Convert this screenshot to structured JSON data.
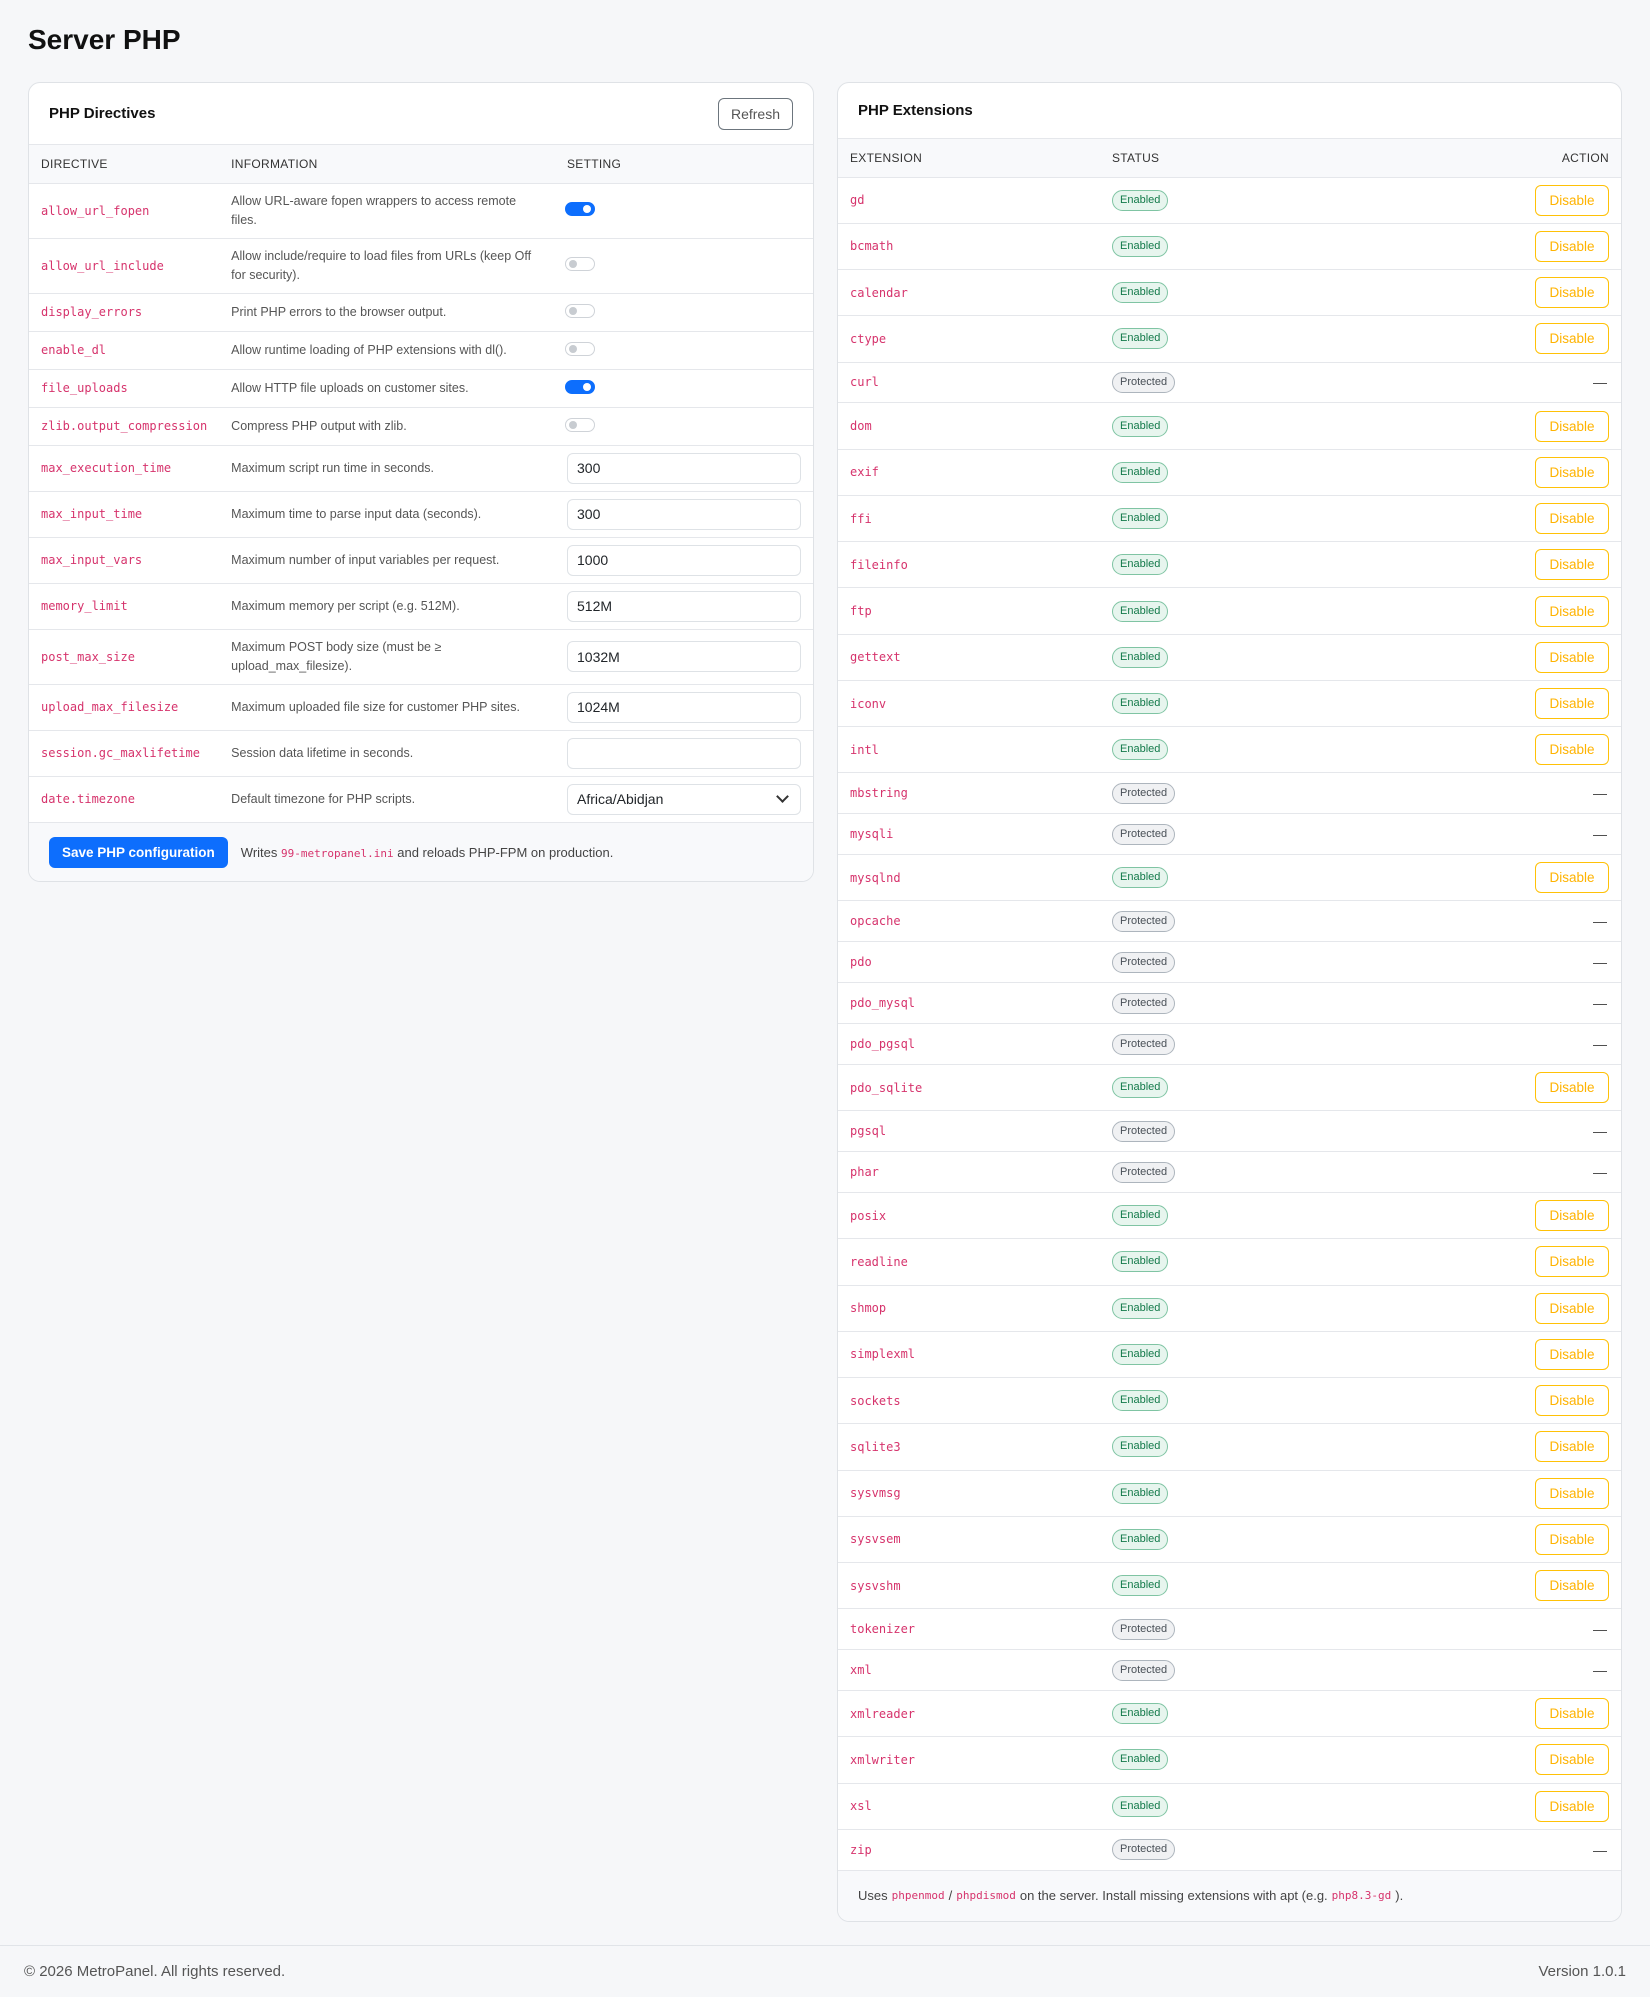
{
  "page": {
    "title": "Server PHP"
  },
  "directives_card": {
    "title": "PHP Directives",
    "refresh_label": "Refresh",
    "columns": [
      "DIRECTIVE",
      "INFORMATION",
      "SETTING"
    ],
    "rows": [
      {
        "name": "allow_url_fopen",
        "info": "Allow URL-aware fopen wrappers to access remote files.",
        "kind": "toggle",
        "on": true
      },
      {
        "name": "allow_url_include",
        "info": "Allow include/require to load files from URLs (keep Off for security).",
        "kind": "toggle",
        "on": false
      },
      {
        "name": "display_errors",
        "info": "Print PHP errors to the browser output.",
        "kind": "toggle",
        "on": false
      },
      {
        "name": "enable_dl",
        "info": "Allow runtime loading of PHP extensions with dl().",
        "kind": "toggle",
        "on": false
      },
      {
        "name": "file_uploads",
        "info": "Allow HTTP file uploads on customer sites.",
        "kind": "toggle",
        "on": true
      },
      {
        "name": "zlib.output_compression",
        "info": "Compress PHP output with zlib.",
        "kind": "toggle",
        "on": false
      },
      {
        "name": "max_execution_time",
        "info": "Maximum script run time in seconds.",
        "kind": "input",
        "value": "300"
      },
      {
        "name": "max_input_time",
        "info": "Maximum time to parse input data (seconds).",
        "kind": "input",
        "value": "300"
      },
      {
        "name": "max_input_vars",
        "info": "Maximum number of input variables per request.",
        "kind": "input",
        "value": "1000"
      },
      {
        "name": "memory_limit",
        "info": "Maximum memory per script (e.g. 512M).",
        "kind": "input",
        "value": "512M"
      },
      {
        "name": "post_max_size",
        "info": "Maximum POST body size (must be ≥ upload_max_filesize).",
        "kind": "input",
        "value": "1032M"
      },
      {
        "name": "upload_max_filesize",
        "info": "Maximum uploaded file size for customer PHP sites.",
        "kind": "input",
        "value": "1024M"
      },
      {
        "name": "session.gc_maxlifetime",
        "info": "Session data lifetime in seconds.",
        "kind": "input",
        "value": ""
      },
      {
        "name": "date.timezone",
        "info": "Default timezone for PHP scripts.",
        "kind": "select",
        "value": "Africa/Abidjan"
      }
    ],
    "save_label": "Save PHP configuration",
    "footer_prefix": "Writes",
    "footer_file": "99-metropanel.ini",
    "footer_suffix": "and reloads PHP-FPM on production."
  },
  "extensions_card": {
    "title": "PHP Extensions",
    "columns": [
      "EXTENSION",
      "STATUS",
      "ACTION"
    ],
    "enabled_label": "Enabled",
    "protected_label": "Protected",
    "disable_label": "Disable",
    "dash": "—",
    "rows": [
      {
        "name": "gd",
        "status": "Enabled"
      },
      {
        "name": "bcmath",
        "status": "Enabled"
      },
      {
        "name": "calendar",
        "status": "Enabled"
      },
      {
        "name": "ctype",
        "status": "Enabled"
      },
      {
        "name": "curl",
        "status": "Protected"
      },
      {
        "name": "dom",
        "status": "Enabled"
      },
      {
        "name": "exif",
        "status": "Enabled"
      },
      {
        "name": "ffi",
        "status": "Enabled"
      },
      {
        "name": "fileinfo",
        "status": "Enabled"
      },
      {
        "name": "ftp",
        "status": "Enabled"
      },
      {
        "name": "gettext",
        "status": "Enabled"
      },
      {
        "name": "iconv",
        "status": "Enabled"
      },
      {
        "name": "intl",
        "status": "Enabled"
      },
      {
        "name": "mbstring",
        "status": "Protected"
      },
      {
        "name": "mysqli",
        "status": "Protected"
      },
      {
        "name": "mysqlnd",
        "status": "Enabled"
      },
      {
        "name": "opcache",
        "status": "Protected"
      },
      {
        "name": "pdo",
        "status": "Protected"
      },
      {
        "name": "pdo_mysql",
        "status": "Protected"
      },
      {
        "name": "pdo_pgsql",
        "status": "Protected"
      },
      {
        "name": "pdo_sqlite",
        "status": "Enabled"
      },
      {
        "name": "pgsql",
        "status": "Protected"
      },
      {
        "name": "phar",
        "status": "Protected"
      },
      {
        "name": "posix",
        "status": "Enabled"
      },
      {
        "name": "readline",
        "status": "Enabled"
      },
      {
        "name": "shmop",
        "status": "Enabled"
      },
      {
        "name": "simplexml",
        "status": "Enabled"
      },
      {
        "name": "sockets",
        "status": "Enabled"
      },
      {
        "name": "sqlite3",
        "status": "Enabled"
      },
      {
        "name": "sysvmsg",
        "status": "Enabled"
      },
      {
        "name": "sysvsem",
        "status": "Enabled"
      },
      {
        "name": "sysvshm",
        "status": "Enabled"
      },
      {
        "name": "tokenizer",
        "status": "Protected"
      },
      {
        "name": "xml",
        "status": "Protected"
      },
      {
        "name": "xmlreader",
        "status": "Enabled"
      },
      {
        "name": "xmlwriter",
        "status": "Enabled"
      },
      {
        "name": "xsl",
        "status": "Enabled"
      },
      {
        "name": "zip",
        "status": "Protected"
      }
    ],
    "footer_prefix": "Uses",
    "footer_cmd1": "phpenmod",
    "footer_sep": "/",
    "footer_cmd2": "phpdismod",
    "footer_mid": "on the server. Install missing extensions with apt (e.g.",
    "footer_pkg": "php8.3-gd",
    "footer_end": ")."
  },
  "footer": {
    "copyright": "© 2026 MetroPanel. All rights reserved.",
    "version": "Version 1.0.1"
  },
  "colors": {
    "primary": "#0d6efd",
    "warning": "#ffc107",
    "success": "#137a4a",
    "code": "#d6336c"
  }
}
